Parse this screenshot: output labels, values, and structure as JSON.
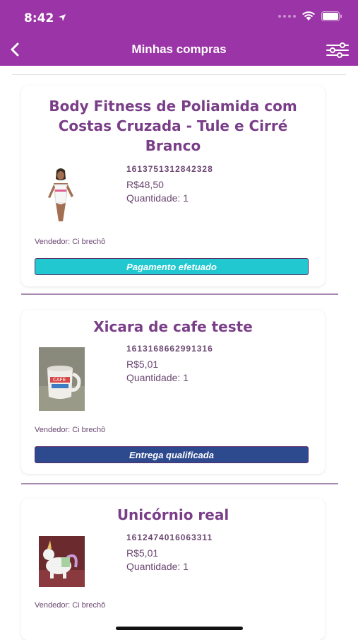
{
  "status_bar": {
    "time": "8:42"
  },
  "nav": {
    "title": "Minhas compras",
    "back_icon": "chevron-left-icon",
    "filter_icon": "sliders-icon"
  },
  "orders": [
    {
      "title_lines": [
        "Body Fitness de Poliamida com",
        "Costas Cruzada - Tule e Cirré",
        "Branco"
      ],
      "id": "1613751312842328",
      "price": "R$48,50",
      "quantity": "Quantidade: 1",
      "seller": "Vendedor: Ci brechô",
      "status": "Pagamento efetuado",
      "status_color": "#21c8cf"
    },
    {
      "title_lines": [
        "Xicara de cafe teste"
      ],
      "id": "1613168662991316",
      "price": "R$5,01",
      "quantity": "Quantidade: 1",
      "seller": "Vendedor: Ci brechô",
      "status": "Entrega qualificada",
      "status_color": "#2e4a8e"
    },
    {
      "title_lines": [
        "Unicórnio real"
      ],
      "id": "1612474016063311",
      "price": "R$5,01",
      "quantity": "Quantidade: 1",
      "seller": "Vendedor: Ci brechô"
    }
  ],
  "colors": {
    "brand": "#9b34a6",
    "text": "#6b4772",
    "title": "#7a3e88"
  }
}
